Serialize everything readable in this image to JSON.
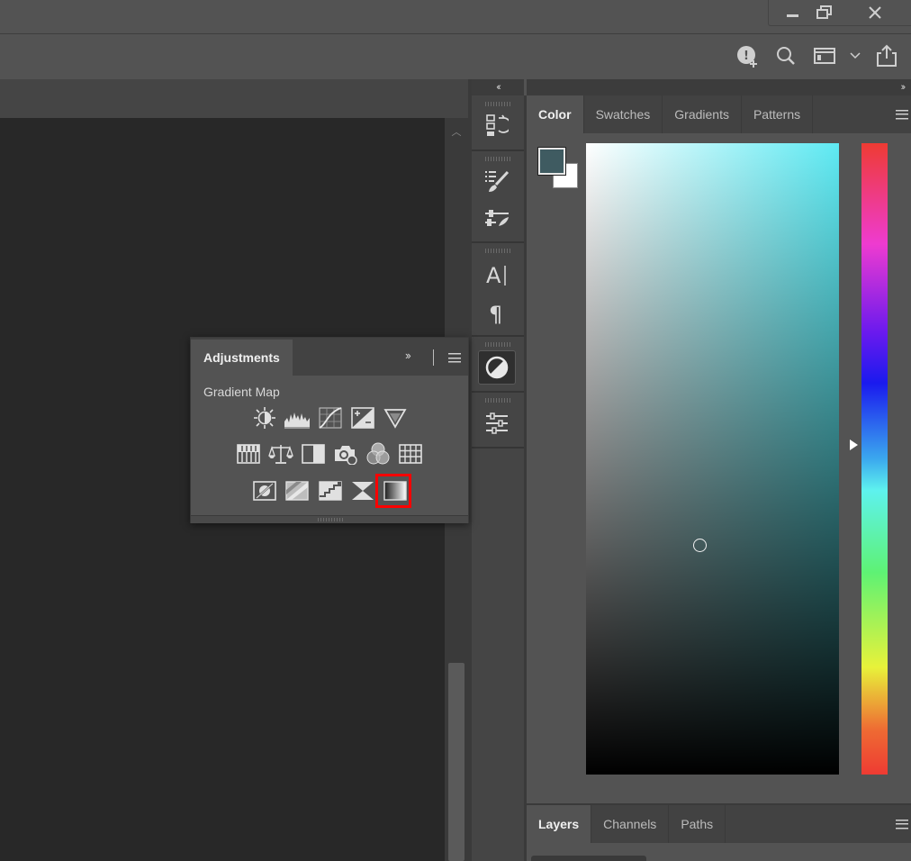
{
  "window_controls": {
    "minimize_icon": "minimize-icon",
    "restore_icon": "restore-icon",
    "close_icon": "close-icon"
  },
  "options_bar": {
    "icons": [
      "learn-add-icon",
      "search-icon",
      "workspace-icon",
      "chevron-down-icon",
      "share-icon"
    ]
  },
  "panel_collapse": {
    "left": "‹‹",
    "right": "››"
  },
  "icon_strip": {
    "buttons": [
      "history-icon",
      "brush-settings-icon",
      "brushes-icon",
      "character-icon",
      "paragraph-icon",
      "adjustments-icon",
      "properties-icon"
    ],
    "active": "adjustments-icon"
  },
  "color_panel": {
    "tabs": [
      "Color",
      "Swatches",
      "Gradients",
      "Patterns"
    ],
    "active_tab": "Color",
    "foreground_color": "#3f5b61",
    "background_color": "#ffffff",
    "hue_color": "#5eeaf3"
  },
  "layers_panel": {
    "tabs": [
      "Layers",
      "Channels",
      "Paths"
    ],
    "active_tab": "Layers"
  },
  "adjustments_panel": {
    "title": "Adjustments",
    "expand": "››",
    "hover_label": "Gradient Map",
    "row1": [
      "brightness-contrast-icon",
      "levels-icon",
      "curves-icon",
      "exposure-icon",
      "vibrance-icon"
    ],
    "row2": [
      "hue-saturation-icon",
      "color-balance-icon",
      "black-white-icon",
      "photo-filter-icon",
      "channel-mixer-icon",
      "color-lookup-icon"
    ],
    "row3": [
      "invert-icon",
      "posterize-icon",
      "threshold-icon",
      "selective-color-icon",
      "gradient-map-icon"
    ],
    "highlighted": "gradient-map-icon",
    "highlight_color": "#ff0000"
  }
}
